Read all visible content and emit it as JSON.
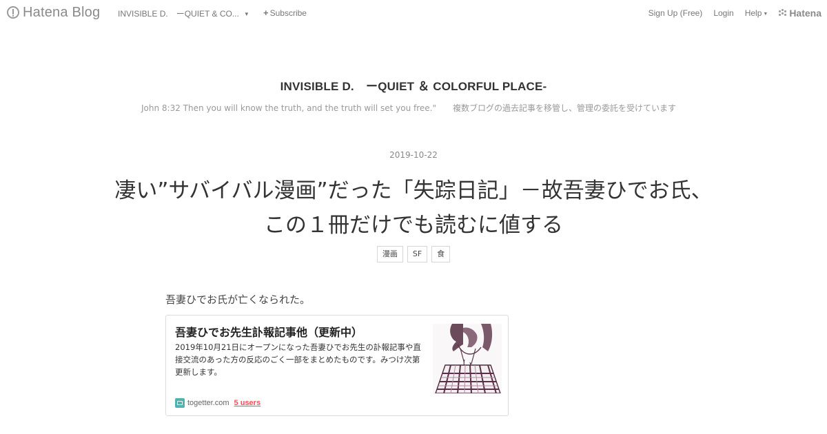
{
  "global_header": {
    "logo_text": "Hatena Blog",
    "blog_name": "INVISIBLE D.　ーQUIET & CO...",
    "subscribe_label": "Subscribe",
    "nav": {
      "signup_label": "Sign Up (Free)",
      "login_label": "Login",
      "help_label": "Help",
      "brand_label": "Hatena"
    }
  },
  "blog": {
    "title": "INVISIBLE D.　ーQUIET ＆ COLORFUL PLACE-",
    "description": "John 8:32 Then you will know the truth, and the truth will set you free.\"　　複数ブログの過去記事を移管し、管理の委託を受けています"
  },
  "entry": {
    "date": "2019-10-22",
    "title_line1": "凄い”サバイバル漫画”だった「失踪日記」－故吾妻ひでお氏、",
    "title_line2": "この１冊だけでも読むに値する",
    "tags": [
      "漫画",
      "SF",
      "食"
    ],
    "first_paragraph": "吾妻ひでお氏が亡くなられた。"
  },
  "embed_card": {
    "title": "吾妻ひでお先生訃報記事他（更新中）",
    "description": "2019年10月21日にオープンになった吾妻ひでお先生の訃報記事や直接交流のあった方の反応のごく一部をまとめたものです。みつけ次第更新します。",
    "site": "togetter.com",
    "users": "5 users"
  },
  "colors": {
    "accent_users": "#ff4b55",
    "favicon": "#4fb3b0"
  }
}
